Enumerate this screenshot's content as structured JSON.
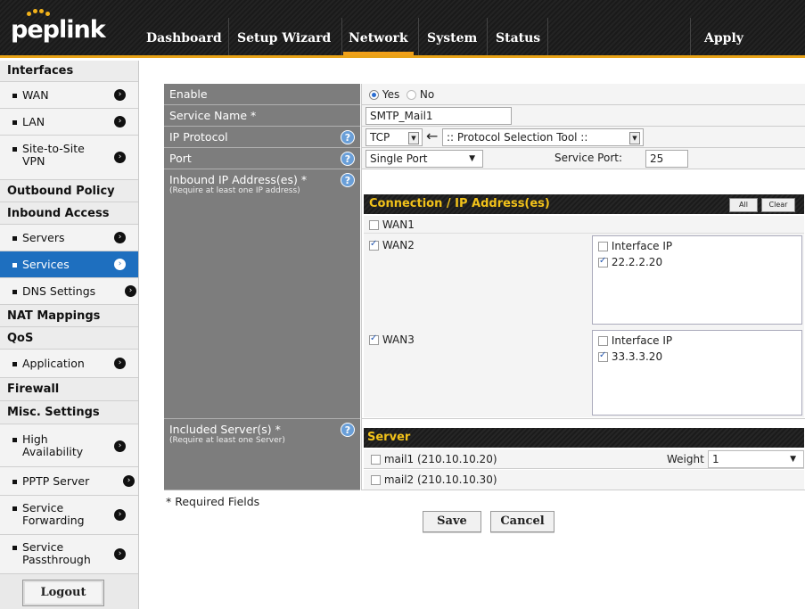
{
  "brand": {
    "name": "peplink",
    "accent": "#f0a01a"
  },
  "nav": {
    "dashboard": "Dashboard",
    "setup_wizard": "Setup Wizard",
    "network": "Network",
    "system": "System",
    "status": "Status",
    "apply_changes": "Apply Changes"
  },
  "sidebar": {
    "interfaces": "Interfaces",
    "wan": "WAN",
    "lan": "LAN",
    "site_to_site_1": "Site-to-Site",
    "site_to_site_2": "VPN",
    "outbound_policy": "Outbound Policy",
    "inbound_access": "Inbound Access",
    "servers": "Servers",
    "services": "Services",
    "dns_settings": "DNS Settings",
    "nat_mappings": "NAT Mappings",
    "qos": "QoS",
    "application": "Application",
    "firewall": "Firewall",
    "misc_settings": "Misc. Settings",
    "high_availability_1": "High",
    "high_availability_2": "Availability",
    "pptp_server": "PPTP Server",
    "service_forwarding_1": "Service",
    "service_forwarding_2": "Forwarding",
    "service_passthrough_1": "Service",
    "service_passthrough_2": "Passthrough",
    "logout": "Logout"
  },
  "form": {
    "enable_label": "Enable",
    "yes": "Yes",
    "no": "No",
    "service_name_label": "Service Name *",
    "service_name_value": "SMTP_Mail1",
    "ip_protocol_label": "IP Protocol",
    "protocol_value": "TCP",
    "protocol_tool": ":: Protocol Selection Tool ::",
    "port_label": "Port",
    "port_mode": "Single Port",
    "service_port_label": "Service Port:",
    "service_port_value": "25",
    "inbound_label": "Inbound IP Address(es) *",
    "inbound_note": "(Require at least one IP address)",
    "conn_header": "Connection / IP Address(es)",
    "all_btn": "All",
    "clear_btn": "Clear",
    "wan1": "WAN1",
    "wan2": "WAN2",
    "wan3": "WAN3",
    "interface_ip": "Interface IP",
    "wan2_ip": "22.2.2.20",
    "wan3_ip": "33.3.3.20",
    "included_label": "Included Server(s) *",
    "included_note": "(Require at least one Server)",
    "server_header": "Server",
    "server1": "mail1 (210.10.10.20)",
    "weight_label": "Weight",
    "weight_value": "1",
    "server2": "mail2 (210.10.10.30)",
    "required_fields": "* Required Fields",
    "save": "Save",
    "cancel": "Cancel"
  }
}
